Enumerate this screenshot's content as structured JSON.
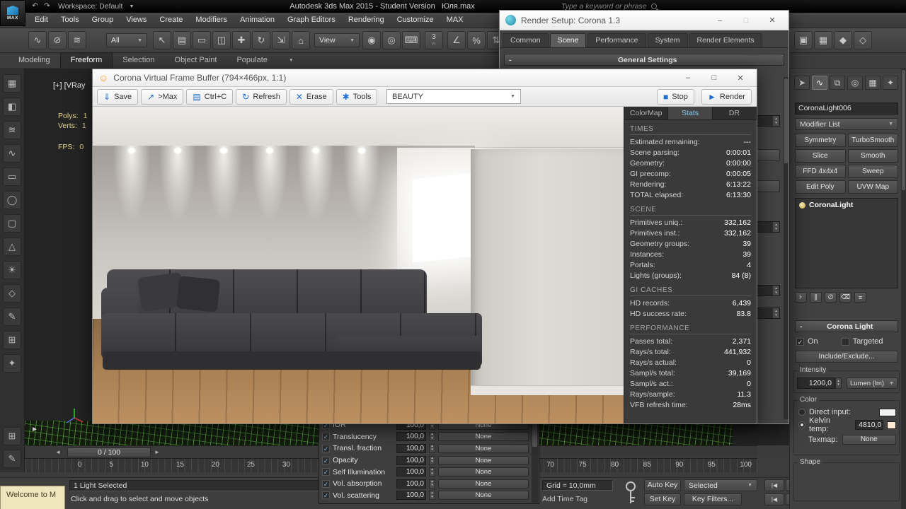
{
  "glyphs": {
    "caret_down": "▼",
    "minimize": "–",
    "maximize": "□",
    "close": "✕",
    "smiley": "☺",
    "undo": "↶",
    "redo": "↷",
    "check": "✓",
    "spin_up": "▴",
    "spin_down": "▾",
    "stop_icon": "■",
    "render_icon": "►",
    "rollout_minus": "-",
    "slider_left": "◄",
    "slider_right": "►",
    "expander": "►",
    "snap_magnet": "∩",
    "grid_btn": "⊞",
    "pencil_btn": "✎"
  },
  "titlebar": {
    "logo_text": "MAX",
    "workspace": "Workspace: Default",
    "app_title": "Autodesk 3ds Max 2015  - Student Version",
    "doc_name": "Юля.max",
    "search_placeholder": "Type a keyword or phrase"
  },
  "menubar": [
    "Edit",
    "Tools",
    "Group",
    "Views",
    "Create",
    "Modifiers",
    "Animation",
    "Graph Editors",
    "Rendering",
    "Customize",
    "MAX"
  ],
  "main_toolbar": {
    "selection_filter": "All",
    "ref_coord": "View",
    "snap_label": "3",
    "icons_a": [
      {
        "name": "select-and-link-icon",
        "glyph": "∿"
      },
      {
        "name": "unlink-selection-icon",
        "glyph": "⊘"
      },
      {
        "name": "bind-to-spacewarp-icon",
        "glyph": "≋"
      }
    ],
    "icons_b": [
      {
        "name": "select-object-icon",
        "glyph": "↖"
      },
      {
        "name": "select-by-name-icon",
        "glyph": "▤"
      },
      {
        "name": "rectangular-selection-region-icon",
        "glyph": "▭"
      },
      {
        "name": "window-crossing-icon",
        "glyph": "◫"
      },
      {
        "name": "select-and-move-icon",
        "glyph": "✚"
      },
      {
        "name": "select-and-rotate-icon",
        "glyph": "↻"
      },
      {
        "name": "select-and-scale-icon",
        "glyph": "⇲"
      },
      {
        "name": "select-and-place-icon",
        "glyph": "⌂"
      }
    ],
    "icons_c": [
      {
        "name": "use-pivot-center-icon",
        "glyph": "◉"
      },
      {
        "name": "select-and-manipulate-icon",
        "glyph": "◎"
      },
      {
        "name": "keyboard-override-icon",
        "glyph": "⌨"
      }
    ],
    "icons_d": [
      {
        "name": "angle-snap-icon",
        "glyph": "∠"
      },
      {
        "name": "percent-snap-icon",
        "glyph": "%"
      },
      {
        "name": "spinner-snap-icon",
        "glyph": "⇅"
      },
      {
        "name": "named-selection-sets-icon",
        "glyph": "≡"
      },
      {
        "name": "mirror-icon",
        "glyph": "⋈"
      },
      {
        "name": "align-icon",
        "glyph": "≡"
      },
      {
        "name": "layer-manager-icon",
        "glyph": "▤"
      },
      {
        "name": "graphite-ribbon-icon",
        "glyph": "▦"
      },
      {
        "name": "curve-editor-icon",
        "glyph": "∿"
      },
      {
        "name": "schematic-view-icon",
        "glyph": "#"
      },
      {
        "name": "material-editor-icon",
        "glyph": "◐"
      }
    ],
    "icons_right": [
      {
        "name": "render-setup-icon",
        "glyph": "▣"
      },
      {
        "name": "rendered-frame-window-icon",
        "glyph": "▦"
      },
      {
        "name": "render-production-icon",
        "glyph": "◆"
      },
      {
        "name": "render-iterative-icon",
        "glyph": "◇"
      }
    ]
  },
  "ribbon": {
    "tabs": [
      "Modeling",
      "Freeform",
      "Selection",
      "Object Paint",
      "Populate"
    ],
    "active": "Freeform"
  },
  "left_toolbar": [
    {
      "name": "polydraw-icon",
      "glyph": "▦"
    },
    {
      "name": "sculpt-brush-icon",
      "glyph": "◧"
    },
    {
      "name": "wave-deform-icon",
      "glyph": "≋"
    },
    {
      "name": "spline-tool-icon",
      "glyph": "∿"
    },
    {
      "name": "plane-tool-icon",
      "glyph": "▭"
    },
    {
      "name": "sphere-tool-icon",
      "glyph": "◯"
    },
    {
      "name": "box-tool-icon",
      "glyph": "▢"
    },
    {
      "name": "cone-tool-icon",
      "glyph": "△"
    },
    {
      "name": "light-tool-icon",
      "glyph": "☀"
    },
    {
      "name": "diamond-tool-icon",
      "glyph": "◇"
    },
    {
      "name": "paint-tool-icon",
      "glyph": "✎"
    },
    {
      "name": "grid-tool-icon",
      "glyph": "⊞"
    },
    {
      "name": "star-tool-icon",
      "glyph": "✦"
    }
  ],
  "viewport": {
    "label": "[+] [VRay",
    "stats": [
      {
        "label": "Polys:",
        "value": "1"
      },
      {
        "label": "Verts:",
        "value": "1"
      },
      {
        "label": "FPS:",
        "value": "0"
      }
    ]
  },
  "render_setup": {
    "title": "Render Setup: Corona 1.3",
    "tabs": [
      "Common",
      "Scene",
      "Performance",
      "System",
      "Render Elements"
    ],
    "active_tab": "Scene",
    "rollout": "General Settings"
  },
  "vfb": {
    "title": "Corona Virtual Frame Buffer (794×466px, 1:1)",
    "toolbar": [
      {
        "name": "save-button",
        "glyph": "⇓",
        "label": "Save"
      },
      {
        "name": "send-to-max-button",
        "glyph": "↗",
        "label": ">Max"
      },
      {
        "name": "copy-button",
        "glyph": "▤",
        "label": "Ctrl+C"
      },
      {
        "name": "refresh-button",
        "glyph": "↻",
        "label": "Refresh"
      },
      {
        "name": "erase-button",
        "glyph": "✕",
        "label": "Erase"
      },
      {
        "name": "tools-button",
        "glyph": "✱",
        "label": "Tools"
      }
    ],
    "pass_select": "BEAUTY",
    "stop_label": "Stop",
    "render_label": "Render",
    "tabs": [
      "ColorMap",
      "Stats",
      "DR"
    ],
    "active_tab": "Stats",
    "stats": {
      "times_title": "TIMES",
      "times": [
        {
          "label": "Estimated remaining:",
          "value": "---"
        },
        {
          "label": "Scene parsing:",
          "value": "0:00:01"
        },
        {
          "label": "Geometry:",
          "value": "0:00:00"
        },
        {
          "label": "GI precomp:",
          "value": "0:00:05"
        },
        {
          "label": "Rendering:",
          "value": "6:13:22"
        },
        {
          "label": "TOTAL elapsed:",
          "value": "6:13:30"
        }
      ],
      "scene_title": "SCENE",
      "scene": [
        {
          "label": "Primitives uniq.:",
          "value": "332,162"
        },
        {
          "label": "Primitives inst.:",
          "value": "332,162"
        },
        {
          "label": "Geometry groups:",
          "value": "39"
        },
        {
          "label": "Instances:",
          "value": "39"
        },
        {
          "label": "Portals:",
          "value": "4"
        },
        {
          "label": "Lights (groups):",
          "value": "84 (8)"
        }
      ],
      "gi_title": "GI CACHES",
      "gi": [
        {
          "label": "HD records:",
          "value": "6,439"
        },
        {
          "label": "HD success rate:",
          "value": "83.8"
        }
      ],
      "perf_title": "PERFORMANCE",
      "perf": [
        {
          "label": "Passes total:",
          "value": "2,371"
        },
        {
          "label": "Rays/s total:",
          "value": "441,932"
        },
        {
          "label": "Rays/s actual:",
          "value": "0"
        },
        {
          "label": "Sampl/s total:",
          "value": "39,169"
        },
        {
          "label": "Sampl/s act.:",
          "value": "0"
        },
        {
          "label": "Rays/sample:",
          "value": "11.3"
        },
        {
          "label": "VFB refresh time:",
          "value": "28ms"
        }
      ]
    }
  },
  "command_panel": {
    "tabs": [
      {
        "name": "create-tab-icon",
        "glyph": "➤"
      },
      {
        "name": "modify-tab-icon",
        "glyph": "∿"
      },
      {
        "name": "hierarchy-tab-icon",
        "glyph": "⧉"
      },
      {
        "name": "motion-tab-icon",
        "glyph": "◎"
      },
      {
        "name": "display-tab-icon",
        "glyph": "▦"
      },
      {
        "name": "utilities-tab-icon",
        "glyph": "✦"
      }
    ],
    "object_name": "CoronaLight006",
    "modifier_list_label": "Modifier List",
    "modifier_buttons": [
      "Symmetry",
      "TurboSmooth",
      "Slice",
      "Smooth",
      "FFD 4x4x4",
      "Sweep",
      "Edit Poly",
      "UVW Map"
    ],
    "stack_item": "CoronaLight",
    "stack_tools": [
      {
        "name": "pin-stack-icon",
        "glyph": "⊦"
      },
      {
        "name": "show-end-result-icon",
        "glyph": "∥"
      },
      {
        "name": "make-unique-icon",
        "glyph": "∅"
      },
      {
        "name": "remove-modifier-icon",
        "glyph": "⌫"
      },
      {
        "name": "configure-modifier-sets-icon",
        "glyph": "≡"
      }
    ],
    "rollout_title": "Corona Light",
    "on_label": "On",
    "targeted_label": "Targeted",
    "include_exclude_label": "Include/Exclude...",
    "intensity_label": "Intensity",
    "intensity_value": "1200,0",
    "units_value": "Lumen (lm)",
    "color_label": "Color",
    "direct_input_label": "Direct input:",
    "kelvin_label": "Kelvin temp:",
    "kelvin_value": "4810,0",
    "texmap_label": "Texmap:",
    "texmap_button": "None",
    "shape_label": "Shape"
  },
  "material_panel": {
    "rows": [
      {
        "label": "IOR",
        "value": "100,0",
        "map": "None"
      },
      {
        "label": "Translucency",
        "value": "100,0",
        "map": "None"
      },
      {
        "label": "Transl. fraction",
        "value": "100,0",
        "map": "None"
      },
      {
        "label": "Opacity",
        "value": "100,0",
        "map": "None"
      },
      {
        "label": "Self Illumination",
        "value": "100,0",
        "map": "None"
      },
      {
        "label": "Vol. absorption",
        "value": "100,0",
        "map": "None"
      },
      {
        "label": "Vol. scattering",
        "value": "100,0",
        "map": "None"
      }
    ]
  },
  "timeline": {
    "slider_value": "0 / 100",
    "ticks_left": [
      "0",
      "5",
      "10",
      "15",
      "20",
      "25",
      "30"
    ],
    "ticks_right": [
      "70",
      "75",
      "80",
      "85",
      "90",
      "95",
      "100"
    ]
  },
  "statusbar": {
    "welcome": "Welcome to M",
    "selection": "1 Light Selected",
    "prompt": "Click and drag to select and move objects",
    "grid": "Grid = 10,0mm",
    "add_time_tag": "Add Time Tag",
    "auto_key": "Auto Key",
    "set_key": "Set Key",
    "key_mode": "Selected",
    "key_filters": "Key Filters...",
    "playback_row1": [
      {
        "name": "go-to-start-button",
        "glyph": "|◀"
      },
      {
        "name": "previous-frame-button",
        "glyph": "◀"
      },
      {
        "name": "play-button",
        "glyph": "▶"
      },
      {
        "name": "next-frame-button",
        "glyph": "▶|"
      },
      {
        "name": "go-to-end-button",
        "glyph": "▶▶"
      }
    ],
    "playback_row2": [
      {
        "name": "key-step-start-button",
        "glyph": "|◀"
      },
      {
        "name": "previous-key-button",
        "glyph": "◀◀"
      },
      {
        "name": "next-key-button",
        "glyph": "▶▶"
      },
      {
        "name": "key-step-end-button",
        "glyph": "▶|"
      },
      {
        "name": "time-config-button",
        "glyph": "⊞"
      }
    ]
  }
}
